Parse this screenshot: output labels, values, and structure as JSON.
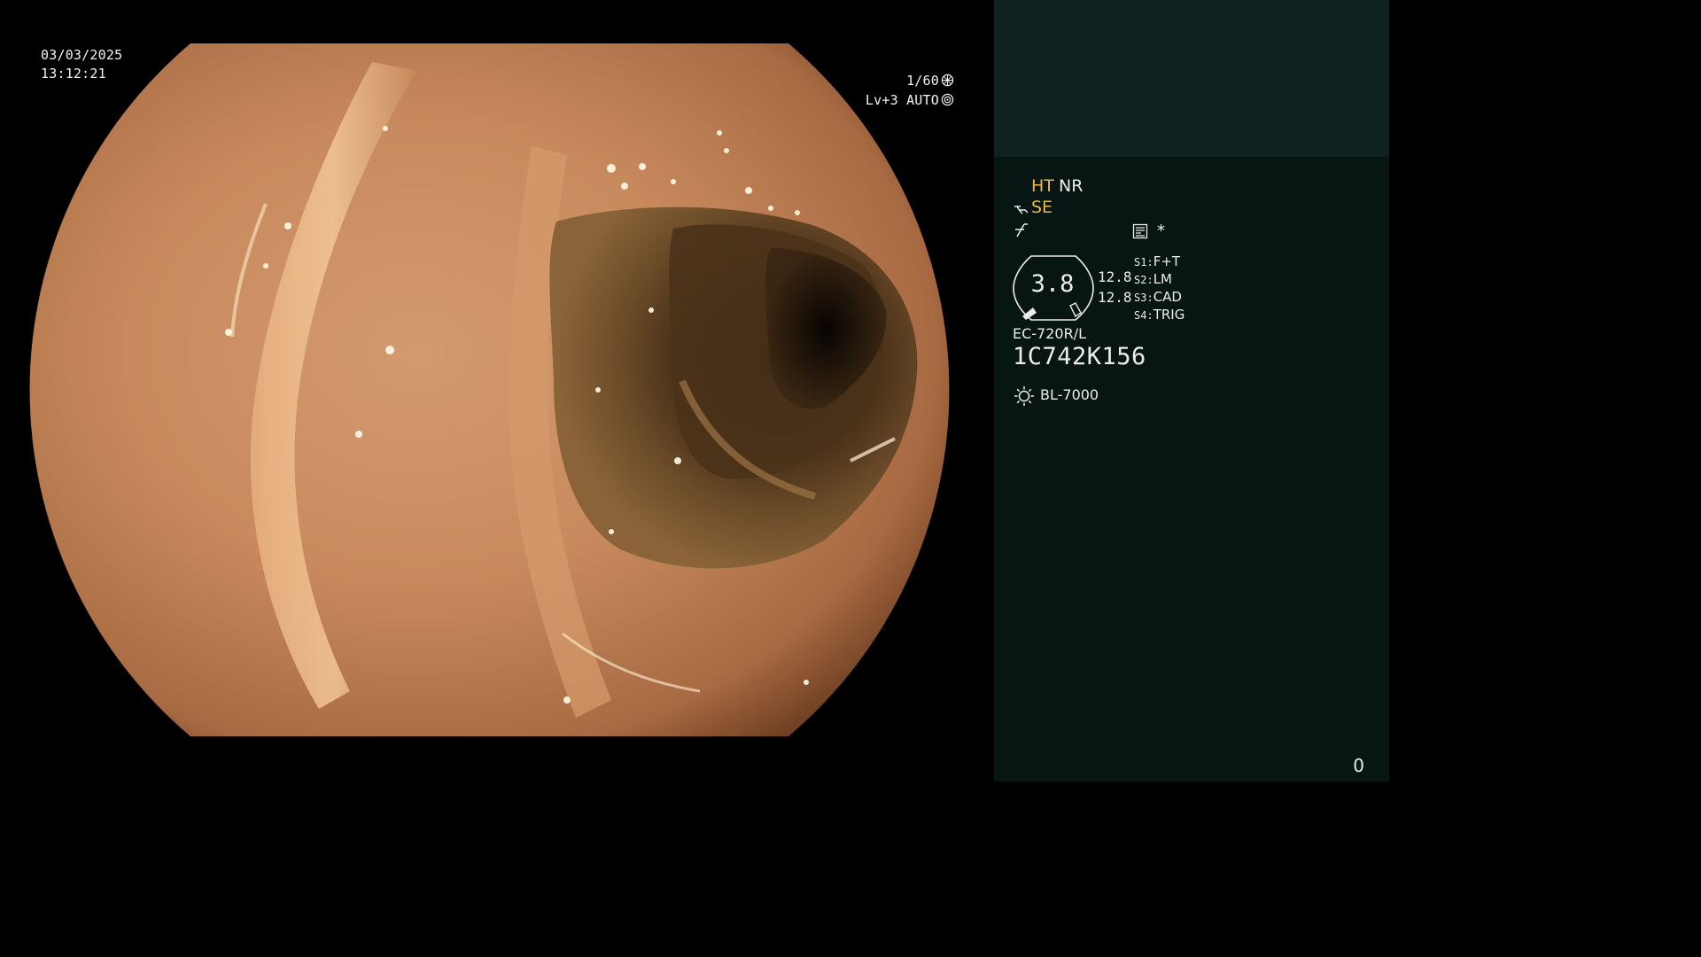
{
  "image": {
    "description_icon": "endoscopy-colon-image"
  },
  "overlay": {
    "date": "03/03/2025",
    "time": "13:12:21",
    "shutter": "1/60",
    "shutter_icon": "shutter-icon",
    "level": "Lv+3",
    "iris_mode": "AUTO",
    "iris_icon": "iris-icon"
  },
  "side_panel": {
    "modes": {
      "ht": "HT",
      "nr": "NR",
      "se": "SE"
    },
    "zoom": "3.8",
    "gauge_top": "12.8",
    "gauge_bottom": "12.8",
    "switches": [
      {
        "key": "S1:",
        "value": "F+T"
      },
      {
        "key": "S2:",
        "value": "LM"
      },
      {
        "key": "S3:",
        "value": "CAD"
      },
      {
        "key": "S4:",
        "value": "TRIG"
      }
    ],
    "star": "*",
    "scope_model": "EC-720R/L",
    "serial_number": "1C742K156",
    "light_source": "BL-7000"
  },
  "footer": {
    "frame_count": "0"
  },
  "colors": {
    "background": "#000000",
    "panel_top": "#0e2220",
    "panel": "#071513",
    "amber": "#f0b64e",
    "text": "#ececec"
  }
}
